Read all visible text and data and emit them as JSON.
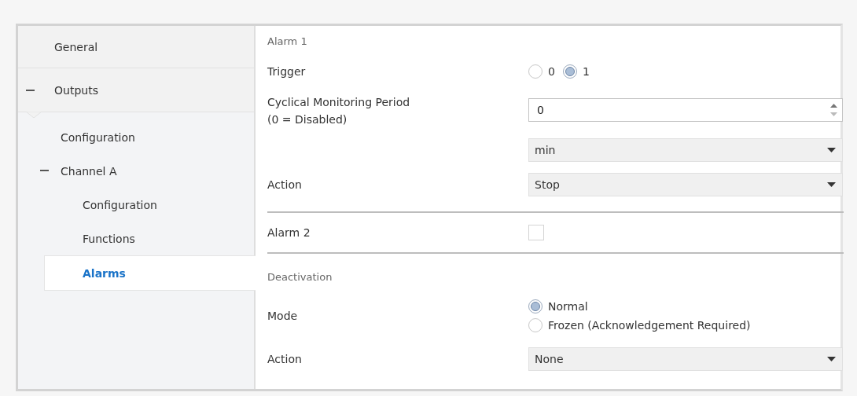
{
  "sidebar": {
    "items": [
      {
        "label": "General",
        "expanded": false,
        "selected": false
      },
      {
        "label": "Outputs",
        "expanded": true,
        "selected": false,
        "children": [
          {
            "label": "Configuration",
            "selected": false
          },
          {
            "label": "Channel A",
            "expanded": true,
            "selected": false,
            "children": [
              {
                "label": "Configuration",
                "selected": false
              },
              {
                "label": "Functions",
                "selected": false
              },
              {
                "label": "Alarms",
                "selected": true
              }
            ]
          }
        ]
      }
    ]
  },
  "content": {
    "rows": [
      {
        "kind": "heading",
        "label": "Alarm 1"
      },
      {
        "kind": "radio",
        "label": "Trigger",
        "stacked": false,
        "options": [
          {
            "label": "0",
            "selected": false
          },
          {
            "label": "1",
            "selected": true
          }
        ]
      },
      {
        "kind": "number",
        "label": "Cyclical Monitoring Period\n(0 = Disabled)",
        "value": "0"
      },
      {
        "kind": "dropdown",
        "value": "min"
      },
      {
        "kind": "dropdown",
        "label": "Action",
        "value": "Stop"
      },
      {
        "kind": "divider"
      },
      {
        "kind": "checkbox",
        "label": "Alarm 2",
        "checked": false
      },
      {
        "kind": "divider"
      },
      {
        "kind": "heading",
        "label": "Deactivation"
      },
      {
        "kind": "radio",
        "label": "Mode",
        "stacked": true,
        "options": [
          {
            "label": "Normal",
            "selected": true
          },
          {
            "label": "Frozen (Acknowledgement Required)",
            "selected": false
          }
        ]
      },
      {
        "kind": "dropdown",
        "label": "Action",
        "value": "None"
      }
    ]
  }
}
